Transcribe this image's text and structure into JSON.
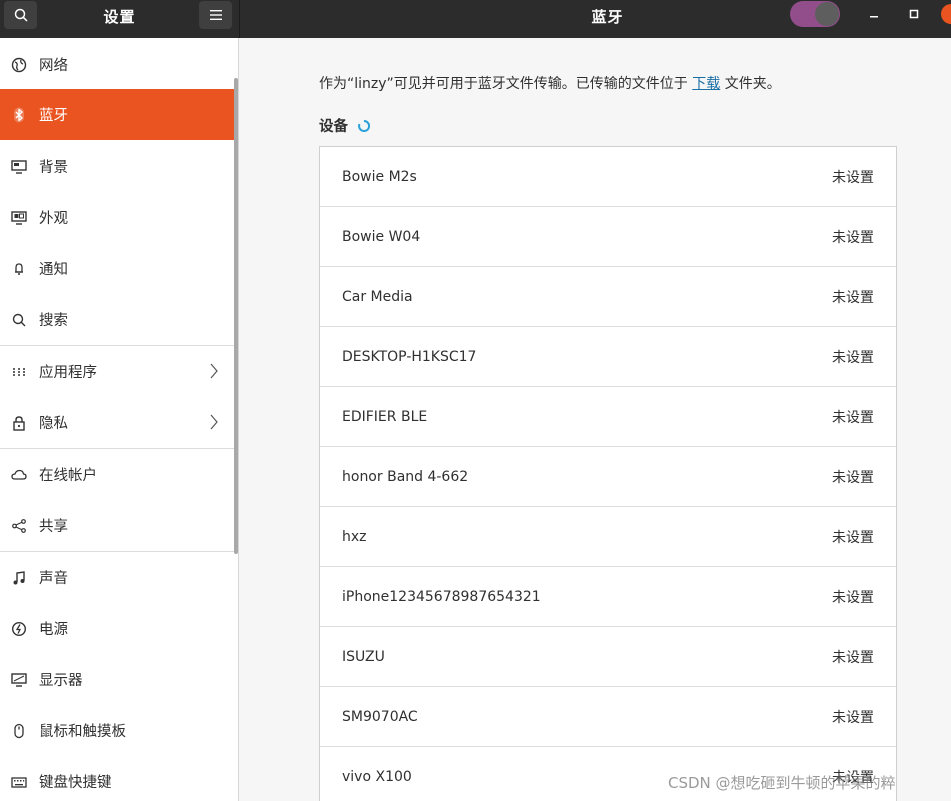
{
  "header": {
    "left_title": "设置",
    "main_title": "蓝牙",
    "bluetooth_enabled": true
  },
  "sidebar": {
    "items": [
      {
        "label": "网络",
        "icon": "globe-icon"
      },
      {
        "label": "蓝牙",
        "icon": "bluetooth-icon",
        "active": true
      },
      {
        "label": "背景",
        "icon": "monitor-icon"
      },
      {
        "label": "外观",
        "icon": "appearance-icon"
      },
      {
        "label": "通知",
        "icon": "bell-icon"
      },
      {
        "label": "搜索",
        "icon": "search-icon"
      },
      {
        "label": "应用程序",
        "icon": "apps-grid-icon",
        "has_submenu": true
      },
      {
        "label": "隐私",
        "icon": "lock-icon",
        "has_submenu": true
      },
      {
        "label": "在线帐户",
        "icon": "cloud-icon"
      },
      {
        "label": "共享",
        "icon": "share-icon"
      },
      {
        "label": "声音",
        "icon": "music-note-icon"
      },
      {
        "label": "电源",
        "icon": "power-icon"
      },
      {
        "label": "显示器",
        "icon": "display-icon"
      },
      {
        "label": "鼠标和触摸板",
        "icon": "mouse-icon"
      },
      {
        "label": "键盘快捷键",
        "icon": "keyboard-icon"
      }
    ]
  },
  "main": {
    "info_prefix": "作为“linzy”可见并可用于蓝牙文件传输。已传输的文件位于",
    "info_link": "下载",
    "info_suffix": "文件夹。",
    "devices_heading": "设备",
    "devices": [
      {
        "name": "Bowie M2s",
        "status": "未设置"
      },
      {
        "name": "Bowie W04",
        "status": "未设置"
      },
      {
        "name": "Car Media",
        "status": "未设置"
      },
      {
        "name": "DESKTOP-H1KSC17",
        "status": "未设置"
      },
      {
        "name": "EDIFIER BLE",
        "status": "未设置"
      },
      {
        "name": "honor Band 4-662",
        "status": "未设置"
      },
      {
        "name": "hxz",
        "status": "未设置"
      },
      {
        "name": "iPhone12345678987654321",
        "status": "未设置"
      },
      {
        "name": "ISUZU",
        "status": "未设置"
      },
      {
        "name": "SM9070AC",
        "status": "未设置"
      },
      {
        "name": "vivo X100",
        "status": "未设置"
      }
    ]
  },
  "watermark": "CSDN @想吃砸到牛顿的苹果的粹",
  "colors": {
    "accent": "#e95420",
    "toggle": "#924d8b",
    "link": "#1a6fa5",
    "headerbar": "#2c2c2c"
  }
}
